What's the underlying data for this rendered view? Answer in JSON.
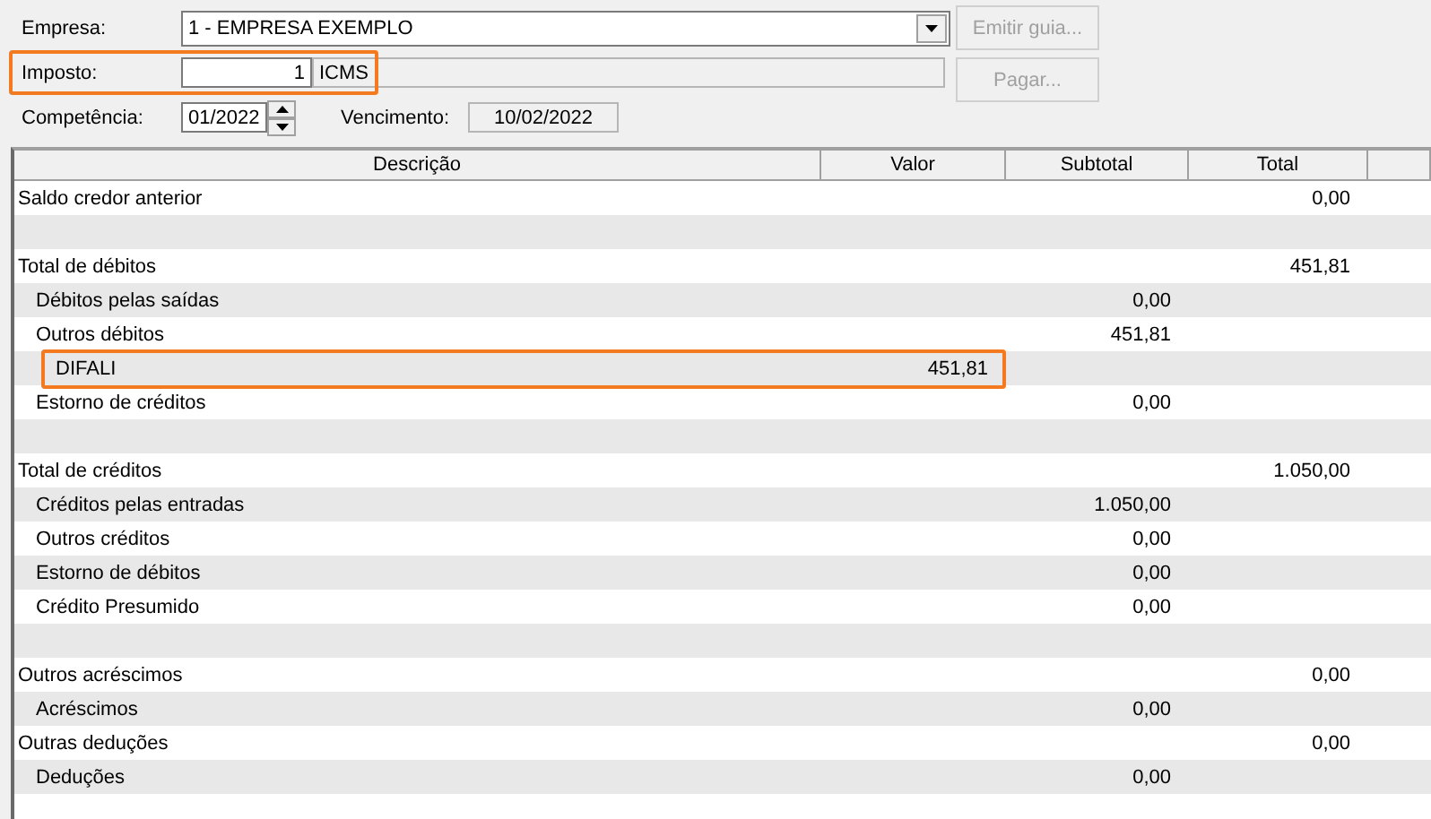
{
  "form": {
    "empresa": {
      "label": "Empresa:",
      "value": "1 - EMPRESA EXEMPLO"
    },
    "imposto": {
      "label": "Imposto:",
      "code": "1",
      "name": "ICMS",
      "highlighted": true
    },
    "competencia": {
      "label": "Competência:",
      "value": "01/2022"
    },
    "vencimento": {
      "label": "Vencimento:",
      "value": "10/02/2022"
    }
  },
  "buttons": [
    {
      "label": "Emitir guia...",
      "disabled": true
    },
    {
      "label": "Pagar...",
      "disabled": true
    }
  ],
  "table": {
    "columns": [
      "Descrição",
      "Valor",
      "Subtotal",
      "Total"
    ],
    "rows": [
      {
        "kind": "line",
        "description": "Saldo credor anterior",
        "total": "0,00",
        "highlighted": false
      },
      {
        "kind": "spacer"
      },
      {
        "kind": "line",
        "description": "Total de débitos",
        "total": "451,81",
        "highlighted": false,
        "children": [
          {
            "kind": "line",
            "description": "Débitos pelas saídas",
            "subtotal": "0,00",
            "highlighted": false
          },
          {
            "kind": "line",
            "description": "Outros débitos",
            "subtotal": "451,81",
            "highlighted": false,
            "children": [
              {
                "kind": "line",
                "description": "DIFALI",
                "valor": "451,81",
                "highlighted": true
              }
            ]
          },
          {
            "kind": "line",
            "description": "Estorno de créditos",
            "subtotal": "0,00",
            "highlighted": false
          }
        ]
      },
      {
        "kind": "spacer"
      },
      {
        "kind": "line",
        "description": "Total de créditos",
        "total": "1.050,00",
        "highlighted": false,
        "children": [
          {
            "kind": "line",
            "description": "Créditos pelas entradas",
            "subtotal": "1.050,00",
            "highlighted": false
          },
          {
            "kind": "line",
            "description": "Outros créditos",
            "subtotal": "0,00",
            "highlighted": false
          },
          {
            "kind": "line",
            "description": "Estorno de débitos",
            "subtotal": "0,00",
            "highlighted": false
          },
          {
            "kind": "line",
            "description": "Crédito Presumido",
            "subtotal": "0,00",
            "highlighted": false
          }
        ]
      },
      {
        "kind": "spacer"
      },
      {
        "kind": "line",
        "description": "Outros acréscimos",
        "total": "0,00",
        "highlighted": false,
        "children": [
          {
            "kind": "line",
            "description": "Acréscimos",
            "subtotal": "0,00",
            "highlighted": false
          }
        ]
      },
      {
        "kind": "line",
        "description": "Outras deduções",
        "total": "0,00",
        "highlighted": false,
        "children": [
          {
            "kind": "line",
            "description": "Deduções",
            "subtotal": "0,00",
            "highlighted": false
          }
        ]
      }
    ]
  }
}
